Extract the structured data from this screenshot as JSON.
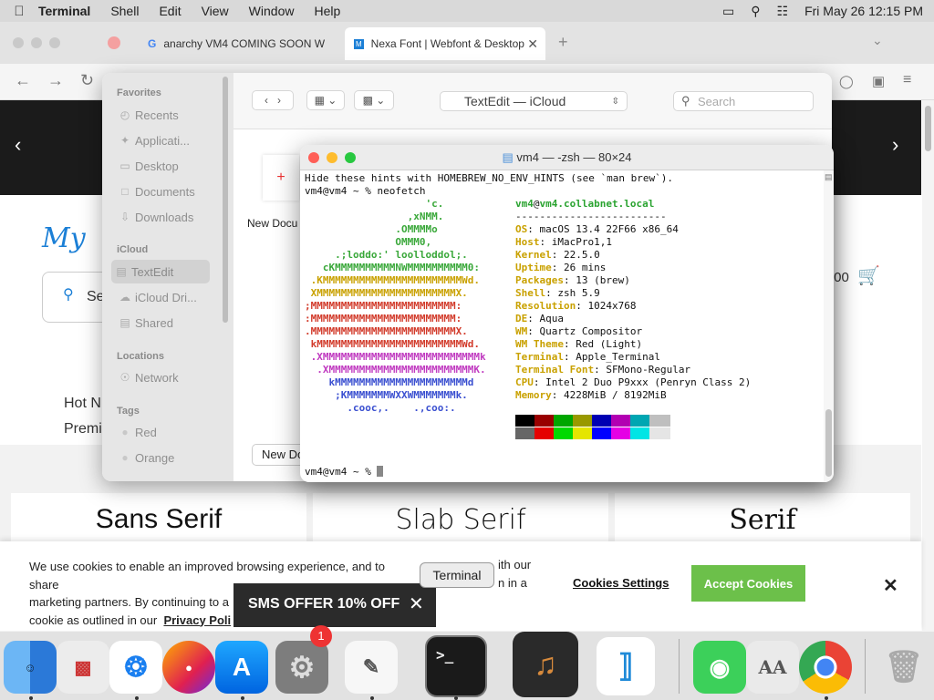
{
  "menubar": {
    "app": "Terminal",
    "items": [
      "Shell",
      "Edit",
      "View",
      "Window",
      "Help"
    ],
    "datetime": "Fri May 26  12:15 PM"
  },
  "browser": {
    "tabs": [
      {
        "label": "anarchy VM4 COMING SOON W"
      },
      {
        "label": "Nexa Font | Webfont & Desktop"
      }
    ],
    "page": {
      "search_label": "Se",
      "hot_label": "Hot N",
      "premium_label": "Premi",
      "price": ".00",
      "font_categories": [
        "Sans Serif",
        "Slab Serif",
        "Serif"
      ]
    },
    "cookie": {
      "line1": "We use cookies to enable an improved browsing experience, and to share",
      "line2": "marketing partners. By continuing to a",
      "line3": "cookie as outlined in our",
      "privacy_link": "Privacy Poli",
      "tail1": "ith our",
      "tail2": "n in a",
      "settings_label": "Cookies Settings",
      "accept_label": "Accept Cookies"
    },
    "sms_offer": "SMS OFFER 10% OFF"
  },
  "finder": {
    "sidebar": {
      "favorites_header": "Favorites",
      "favorites": [
        "Recents",
        "Applicati...",
        "Desktop",
        "Documents",
        "Downloads"
      ],
      "icloud_header": "iCloud",
      "icloud": [
        "TextEdit",
        "iCloud Dri...",
        "Shared"
      ],
      "locations_header": "Locations",
      "locations": [
        "Network"
      ],
      "tags_header": "Tags",
      "tags": [
        {
          "label": "Red",
          "color": "#c8c8c8"
        },
        {
          "label": "Orange",
          "color": "#c8c8c8"
        }
      ]
    },
    "location": "TextEdit — iCloud",
    "search_placeholder": "Search",
    "new_doc_label": "New Docu",
    "new_doc_button": "New Do"
  },
  "terminal": {
    "title": "vm4 — -zsh — 80×24",
    "hint_line": "Hide these hints with HOMEBREW_NO_ENV_HINTS (see `man brew`).",
    "prompt_line": "vm4@vm4 ~ % neofetch",
    "user": "vm4",
    "host": "vm4.collabnet.local",
    "separator": "-------------------------",
    "info": [
      {
        "key": "OS",
        "value": "macOS 13.4 22F66 x86_64"
      },
      {
        "key": "Host",
        "value": "iMacPro1,1"
      },
      {
        "key": "Kernel",
        "value": "22.5.0"
      },
      {
        "key": "Uptime",
        "value": "26 mins"
      },
      {
        "key": "Packages",
        "value": "13 (brew)"
      },
      {
        "key": "Shell",
        "value": "zsh 5.9"
      },
      {
        "key": "Resolution",
        "value": "1024x768"
      },
      {
        "key": "DE",
        "value": "Aqua"
      },
      {
        "key": "WM",
        "value": "Quartz Compositor"
      },
      {
        "key": "WM Theme",
        "value": "Red (Light)"
      },
      {
        "key": "Terminal",
        "value": "Apple_Terminal"
      },
      {
        "key": "Terminal Font",
        "value": "SFMono-Regular"
      },
      {
        "key": "CPU",
        "value": "Intel 2 Duo P9xxx (Penryn Class 2)"
      },
      {
        "key": "Memory",
        "value": "4228MiB / 8192MiB"
      }
    ],
    "logo_lines": [
      {
        "text": "                    'c.",
        "color": "#3aa83a"
      },
      {
        "text": "                 ,xNMM.",
        "color": "#3aa83a"
      },
      {
        "text": "               .OMMMMo",
        "color": "#3aa83a"
      },
      {
        "text": "               OMMM0,",
        "color": "#3aa83a"
      },
      {
        "text": "     .;loddo:' loolloddol;.",
        "color": "#3aa83a"
      },
      {
        "text": "   cKMMMMMMMMMMNWMMMMMMMMMM0:",
        "color": "#3aa83a"
      },
      {
        "text": " .KMMMMMMMMMMMMMMMMMMMMMMMWd.",
        "color": "#c9a100"
      },
      {
        "text": " XMMMMMMMMMMMMMMMMMMMMMMMX.",
        "color": "#c9a100"
      },
      {
        "text": ";MMMMMMMMMMMMMMMMMMMMMMMM:",
        "color": "#d23b2b"
      },
      {
        "text": ":MMMMMMMMMMMMMMMMMMMMMMMM:",
        "color": "#d23b2b"
      },
      {
        "text": ".MMMMMMMMMMMMMMMMMMMMMMMMX.",
        "color": "#d23b2b"
      },
      {
        "text": " kMMMMMMMMMMMMMMMMMMMMMMMMWd.",
        "color": "#d23b2b"
      },
      {
        "text": " .XMMMMMMMMMMMMMMMMMMMMMMMMMMk",
        "color": "#c03ac0"
      },
      {
        "text": "  .XMMMMMMMMMMMMMMMMMMMMMMMMK.",
        "color": "#c03ac0"
      },
      {
        "text": "    kMMMMMMMMMMMMMMMMMMMMMMd",
        "color": "#3a4fd0"
      },
      {
        "text": "     ;KMMMMMMMWXXWMMMMMMMk.",
        "color": "#3a4fd0"
      },
      {
        "text": "       .cooc,.    .,coo:.",
        "color": "#3a4fd0"
      }
    ],
    "palette_top": [
      "#000000",
      "#990000",
      "#00a600",
      "#999900",
      "#0000b2",
      "#b200b2",
      "#00a6b2",
      "#bfbfbf"
    ],
    "palette_bottom": [
      "#666666",
      "#e50000",
      "#00d900",
      "#e5e500",
      "#0000ff",
      "#e500e5",
      "#00e5e5",
      "#e5e5e5"
    ],
    "final_prompt": "vm4@vm4 ~ % "
  },
  "tooltip": "Terminal",
  "dock": {
    "notification_badge": "1",
    "terminal_icon_text": ">_",
    "font_book_icon_text": "AA"
  }
}
